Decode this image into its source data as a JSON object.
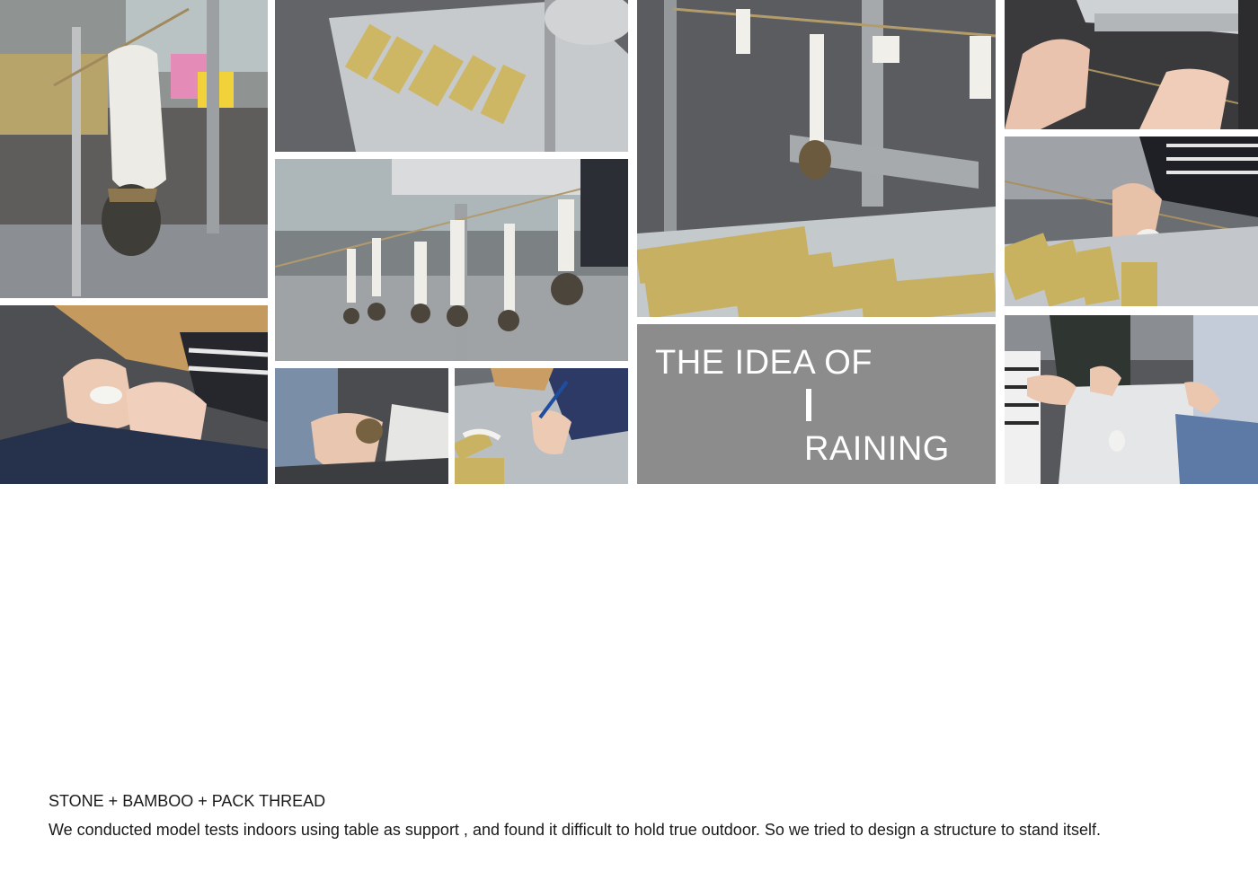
{
  "title_panel": {
    "line1": "THE IDEA OF",
    "line2": "RAINING"
  },
  "caption": {
    "heading": "STONE + BAMBOO + PACK THREAD",
    "body": "We conducted model tests indoors using table as support , and found it difficult to hold true outdoor.  So we tried to design a structure to stand itself."
  },
  "colors": {
    "title_panel_bg": "#8c8c8c",
    "title_text": "#ffffff",
    "caption_text": "#1a1a1a"
  }
}
